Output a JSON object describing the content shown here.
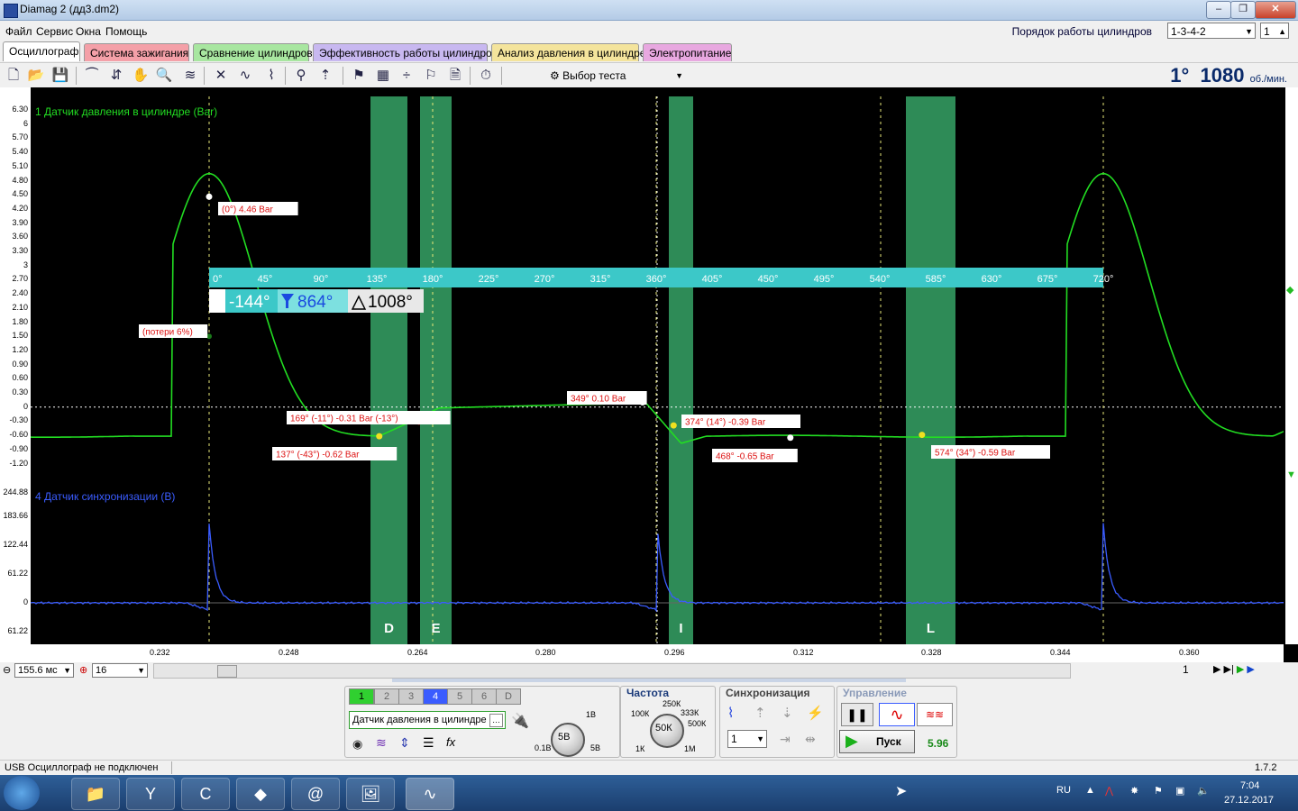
{
  "window": {
    "title": "Diamag 2 (дд3.dm2)"
  },
  "menu": {
    "items": [
      "Файл",
      "Сервис",
      "Окна",
      "Помощь"
    ],
    "order_label": "Порядок работы цилиндров",
    "order_value": "1-3-4-2",
    "cylinder_value": "1"
  },
  "tabs": [
    {
      "label": "Осциллограф",
      "color": "#ffffff",
      "active": true
    },
    {
      "label": "Система зажигания",
      "color": "#f4a0a8"
    },
    {
      "label": "Сравнение цилиндров",
      "color": "#a8e6a0"
    },
    {
      "label": "Эффективность работы цилиндров",
      "color": "#c8b8f0"
    },
    {
      "label": "Анализ давления в цилиндре",
      "color": "#f4e49c"
    },
    {
      "label": "Электропитание",
      "color": "#e8a8e0"
    }
  ],
  "toolbar": {
    "test_select": "Выбор теста",
    "angle": "1°",
    "rpm": "1080",
    "rpm_unit": "об./мин."
  },
  "scope": {
    "channel1_label": "1 Датчик давления в цилиндре (Bar)",
    "channel4_label": "4 Датчик синхронизации (В)",
    "y_ticks_ch1": [
      "6.30",
      "6",
      "5.70",
      "5.40",
      "5.10",
      "4.80",
      "4.50",
      "4.20",
      "3.90",
      "3.60",
      "3.30",
      "3",
      "2.70",
      "2.40",
      "2.10",
      "1.80",
      "1.50",
      "1.20",
      "0.90",
      "0.60",
      "0.30",
      "0",
      "-0.30",
      "-0.60",
      "-0.90",
      "-1.20"
    ],
    "y_ticks_ch4": [
      "244.88",
      "183.66",
      "122.44",
      "61.22",
      "0",
      "61.22"
    ],
    "x_ticks": [
      "0.232",
      "0.248",
      "0.264",
      "0.280",
      "0.296",
      "0.312",
      "0.328",
      "0.344",
      "0.360"
    ],
    "degree_ticks": [
      "0°",
      "45°",
      "90°",
      "135°",
      "180°",
      "225°",
      "270°",
      "315°",
      "360°",
      "405°",
      "450°",
      "495°",
      "540°",
      "585°",
      "630°",
      "675°",
      "720°"
    ],
    "cursor_a": "-144°",
    "cursor_b": "864°",
    "cursor_delta": "1008°",
    "zones": [
      "D",
      "E",
      "I",
      "L"
    ],
    "annotations": [
      "(0°) 4.46 Bar",
      "(потери 6%)",
      "169° (-11°) -0.31 Bar (-13°)",
      "137° (-43°) -0.62 Bar",
      "349° 0.10 Bar",
      "374° (14°) -0.39 Bar",
      "468° -0.65 Bar",
      "574° (34°) -0.59 Bar"
    ],
    "colors": {
      "pressure": "#22dd22",
      "sync": "#3a5cff",
      "zone": "#2e8b57",
      "annotation": "#dd1111",
      "degree_ruler": "#3cc8c8"
    }
  },
  "scroll": {
    "timebase": "155.6 мс",
    "count": "16",
    "page": "1"
  },
  "controls": {
    "channel_buttons": [
      "1",
      "2",
      "3",
      "4",
      "5",
      "6",
      "D"
    ],
    "sensor_name": "Датчик давления в цилиндре",
    "amp_knob": {
      "value": "5В",
      "labels": [
        "1В",
        "0.1В",
        "5В"
      ]
    },
    "freq_title": "Частота",
    "freq_knob": {
      "value": "50К",
      "labels": [
        "250К",
        "100К",
        "333К",
        "500К",
        "1К",
        "1М"
      ]
    },
    "sync_title": "Синхронизация",
    "sync_value": "1",
    "control_title": "Управление",
    "start_label": "Пуск",
    "readout": "5.96"
  },
  "status": {
    "text": "USB Осциллограф не подключен",
    "version": "1.7.2"
  },
  "taskbar": {
    "lang": "RU",
    "time": "7:04",
    "date": "27.12.2017"
  }
}
